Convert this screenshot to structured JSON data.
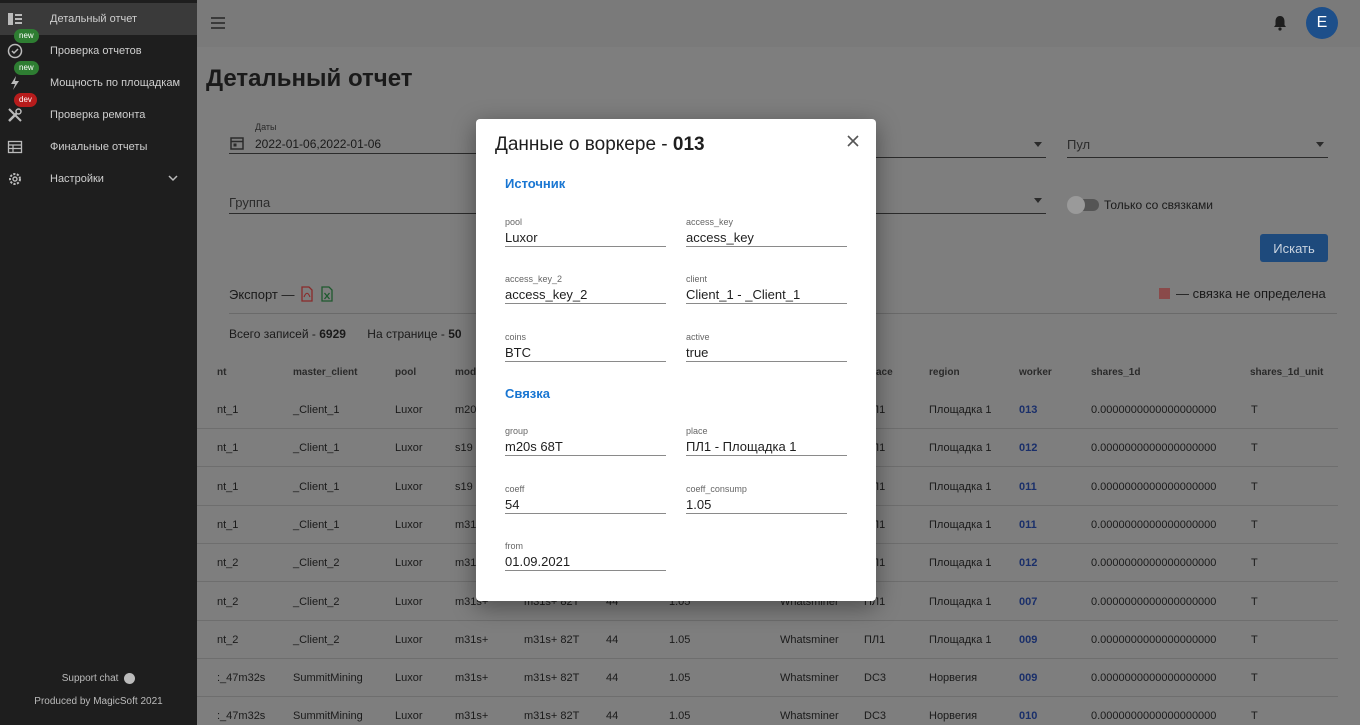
{
  "sidebar": {
    "items": [
      {
        "label": "Детальный отчет",
        "icon": "list-icon",
        "badge": ""
      },
      {
        "label": "Проверка отчетов",
        "icon": "check-circle-icon",
        "badge": "new"
      },
      {
        "label": "Мощность по площадкам",
        "icon": "bolt-icon",
        "badge": "new"
      },
      {
        "label": "Проверка ремонта",
        "icon": "tools-icon",
        "badge": "dev"
      },
      {
        "label": "Финальные отчеты",
        "icon": "table-icon",
        "badge": ""
      },
      {
        "label": "Настройки",
        "icon": "gear-icon",
        "badge": ""
      }
    ],
    "support": "Support chat",
    "produced": "Produced by MagicSoft 2021"
  },
  "header": {
    "avatar_letter": "E"
  },
  "page": {
    "title": "Детальный отчет",
    "filters": {
      "dates_label": "Даты",
      "dates_value": "2022-01-06,2022-01-06",
      "pool_placeholder": "Пул",
      "group_placeholder": "Группа",
      "switch_label": "Только со связками"
    },
    "search_button": "Искать",
    "export_label": "Экспорт —",
    "legend_label": "— связка не определена",
    "total_label": "Всего записей -",
    "total_value": "6929",
    "per_page_label": "На странице -",
    "per_page_value": "50"
  },
  "table": {
    "headers": [
      "nt",
      "master_client",
      "pool",
      "mod",
      "ace",
      "region",
      "worker",
      "shares_1d",
      "shares_1d_unit"
    ],
    "rows": [
      {
        "c0": "nt_1",
        "master": "_Client_1",
        "pool": "Luxor",
        "model": "m20",
        "model2": "",
        "coeff": "",
        "consump": "",
        "vendor": "",
        "place": "ПЛ1",
        "region": "Площадка 1",
        "worker": "013",
        "shares": "0.0000000000000000000",
        "unit": "T"
      },
      {
        "c0": "nt_1",
        "master": "_Client_1",
        "pool": "Luxor",
        "model": "s19",
        "model2": "",
        "coeff": "",
        "consump": "",
        "vendor": "",
        "place": "ПЛ1",
        "region": "Площадка 1",
        "worker": "012",
        "shares": "0.0000000000000000000",
        "unit": "T"
      },
      {
        "c0": "nt_1",
        "master": "_Client_1",
        "pool": "Luxor",
        "model": "s19",
        "model2": "",
        "coeff": "",
        "consump": "",
        "vendor": "",
        "place": "ПЛ1",
        "region": "Площадка 1",
        "worker": "011",
        "shares": "0.0000000000000000000",
        "unit": "T"
      },
      {
        "c0": "nt_1",
        "master": "_Client_1",
        "pool": "Luxor",
        "model": "m31",
        "model2": "",
        "coeff": "",
        "consump": "",
        "vendor": "",
        "place": "ПЛ1",
        "region": "Площадка 1",
        "worker": "011",
        "shares": "0.0000000000000000000",
        "unit": "T"
      },
      {
        "c0": "nt_2",
        "master": "_Client_2",
        "pool": "Luxor",
        "model": "m31",
        "model2": "",
        "coeff": "",
        "consump": "",
        "vendor": "",
        "place": "ПЛ1",
        "region": "Площадка 1",
        "worker": "012",
        "shares": "0.0000000000000000000",
        "unit": "T"
      },
      {
        "c0": "nt_2",
        "master": "_Client_2",
        "pool": "Luxor",
        "model": "m31s+",
        "model2": "m31s+ 82T",
        "coeff": "44",
        "consump": "1.05",
        "vendor": "Whatsminer",
        "place": "ПЛ1",
        "region": "Площадка 1",
        "worker": "007",
        "shares": "0.0000000000000000000",
        "unit": "T"
      },
      {
        "c0": "nt_2",
        "master": "_Client_2",
        "pool": "Luxor",
        "model": "m31s+",
        "model2": "m31s+ 82T",
        "coeff": "44",
        "consump": "1.05",
        "vendor": "Whatsminer",
        "place": "ПЛ1",
        "region": "Площадка 1",
        "worker": "009",
        "shares": "0.0000000000000000000",
        "unit": "T"
      },
      {
        "c0": ":_47m32s",
        "master": "SummitMining",
        "pool": "Luxor",
        "model": "m31s+",
        "model2": "m31s+ 82T",
        "coeff": "44",
        "consump": "1.05",
        "vendor": "Whatsminer",
        "place": "DC3",
        "region": "Норвегия",
        "worker": "009",
        "shares": "0.0000000000000000000",
        "unit": "T"
      },
      {
        "c0": ":_47m32s",
        "master": "SummitMining",
        "pool": "Luxor",
        "model": "m31s+",
        "model2": "m31s+ 82T",
        "coeff": "44",
        "consump": "1.05",
        "vendor": "Whatsminer",
        "place": "DC3",
        "region": "Норвегия",
        "worker": "010",
        "shares": "0.0000000000000000000",
        "unit": "T"
      }
    ]
  },
  "modal": {
    "title_prefix": "Данные о воркере -",
    "title_worker": "013",
    "source_section": "Источник",
    "link_section": "Связка",
    "fields": {
      "pool": {
        "label": "pool",
        "value": "Luxor"
      },
      "access_key": {
        "label": "access_key",
        "value": "access_key"
      },
      "access_key_2": {
        "label": "access_key_2",
        "value": "access_key_2"
      },
      "client": {
        "label": "client",
        "value": "Client_1 - _Client_1"
      },
      "coins": {
        "label": "coins",
        "value": "BTC"
      },
      "active": {
        "label": "active",
        "value": "true"
      },
      "group": {
        "label": "group",
        "value": "m20s 68T"
      },
      "place": {
        "label": "place",
        "value": "ПЛ1 - Площадка 1"
      },
      "coeff": {
        "label": "coeff",
        "value": "54"
      },
      "coeff_consump": {
        "label": "coeff_consump",
        "value": "1.05"
      },
      "from": {
        "label": "from",
        "value": "01.09.2021"
      }
    }
  }
}
